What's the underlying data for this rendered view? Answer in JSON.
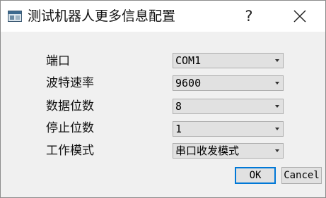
{
  "window": {
    "title": "测试机器人更多信息配置",
    "help_label": "?",
    "icon": "app-window-icon"
  },
  "form": {
    "fields": [
      {
        "label": "端口",
        "value": "COM1"
      },
      {
        "label": "波特速率",
        "value": "9600"
      },
      {
        "label": "数据位数",
        "value": "8"
      },
      {
        "label": "停止位数",
        "value": "1"
      },
      {
        "label": "工作模式",
        "value": "串口收发模式"
      }
    ]
  },
  "buttons": {
    "ok_label": "OK",
    "cancel_label": "Cancel"
  },
  "colors": {
    "dialog_bg": "#f0f0f0",
    "titlebar_bg": "#ffffff",
    "control_bg": "#e1e1e1",
    "default_button_border": "#0078d7"
  }
}
